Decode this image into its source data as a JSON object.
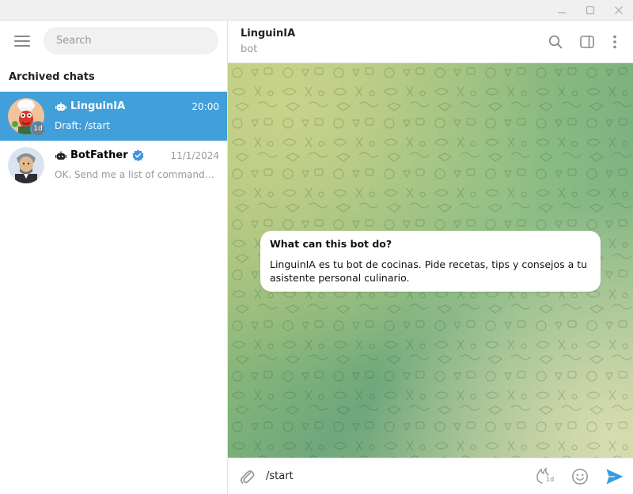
{
  "window": {
    "controls": [
      "minimize-icon",
      "maximize-icon",
      "close-icon"
    ]
  },
  "sidebar": {
    "search_placeholder": "Search",
    "section_title": "Archived chats",
    "chats": [
      {
        "name": "LinguinIA",
        "time": "20:00",
        "draft_label": "Draft:",
        "preview": "/start",
        "active": true,
        "timer_badge": "1d",
        "icon": "bot-icon"
      },
      {
        "name": "BotFather",
        "time": "11/1/2024",
        "preview": "OK. Send me a list of commands for your bot. Please use this format:",
        "active": false,
        "verified": true,
        "icon": "bot-icon"
      }
    ]
  },
  "header": {
    "title": "LinguinIA",
    "subtitle": "bot"
  },
  "message": {
    "title": "What can this bot do?",
    "text": "LinguinIA es tu bot de cocinas. Pide recetas, tips y consejos a tu asistente personal culinario."
  },
  "composer": {
    "value": "/start",
    "timer_label": "1d"
  },
  "colors": {
    "accent": "#419fd9",
    "send": "#3a9be0",
    "verified": "#3d95e0"
  }
}
